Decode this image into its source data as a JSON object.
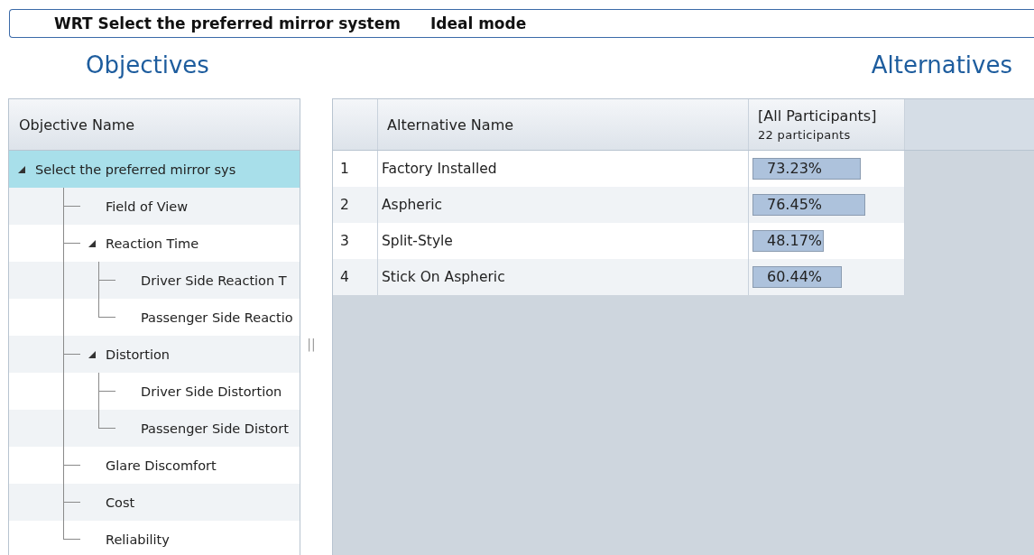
{
  "header": {
    "title": "WRT Select the preferred mirror system",
    "mode": "Ideal mode"
  },
  "objectives": {
    "heading": "Objectives",
    "column": "Objective Name",
    "tree": [
      {
        "label": "Select the preferred mirror sys",
        "selected": true,
        "expanded": true,
        "children": [
          {
            "label": "Field of View",
            "selected": false
          },
          {
            "label": "Reaction Time",
            "selected": false,
            "expanded": true,
            "children": [
              {
                "label": "Driver Side Reaction T",
                "selected": false
              },
              {
                "label": "Passenger Side Reactio",
                "selected": false
              }
            ]
          },
          {
            "label": "Distortion",
            "selected": false,
            "expanded": true,
            "children": [
              {
                "label": "Driver Side Distortion",
                "selected": false
              },
              {
                "label": "Passenger Side Distort",
                "selected": false
              }
            ]
          },
          {
            "label": "Glare Discomfort",
            "selected": false
          },
          {
            "label": "Cost",
            "selected": false
          },
          {
            "label": "Reliability",
            "selected": false
          }
        ]
      }
    ]
  },
  "splitter": "||",
  "alternatives": {
    "heading": "Alternatives",
    "columns": [
      "Alternative Name",
      "[All Participants]"
    ],
    "participants": "22 participants",
    "rows": [
      {
        "index": "1",
        "name": "Factory Installed",
        "score": "73.23%",
        "level": 0.7323
      },
      {
        "index": "2",
        "name": "Aspheric",
        "score": "76.45%",
        "level": 0.7645
      },
      {
        "index": "3",
        "name": "Split-Style",
        "score": "48.17%",
        "level": 0.4817
      },
      {
        "index": "4",
        "name": "Stick On Aspheric",
        "score": "60.44%",
        "level": 0.6044
      }
    ]
  }
}
